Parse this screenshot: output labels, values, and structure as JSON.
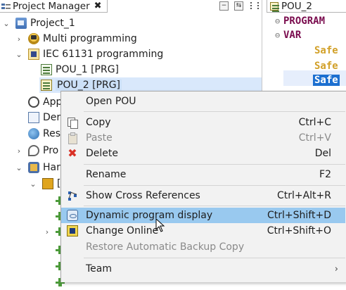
{
  "project_manager": {
    "tab_title": "Project Manager",
    "close_glyph": "✖",
    "toolbar": {
      "collapse_glyph": "−",
      "link_glyph": "⇆"
    },
    "tree": [
      {
        "label": "Project_1",
        "icon": "project-icon",
        "twisty": "expanded"
      },
      {
        "label": "Multi programming",
        "icon": "multi-programming-icon",
        "twisty": "collapsed"
      },
      {
        "label": "IEC 61131 programming",
        "icon": "iec-icon",
        "twisty": "expanded"
      },
      {
        "label": "POU_1 [PRG]",
        "icon": "pou-icon"
      },
      {
        "label": "POU_2 [PRG]",
        "icon": "pou-icon",
        "selected": true
      },
      {
        "label": "App",
        "icon": "gauge-icon"
      },
      {
        "label": "Der",
        "icon": "document-icon"
      },
      {
        "label": "Res",
        "icon": "globe-icon"
      },
      {
        "label": "Pro",
        "icon": "program-icon",
        "twisty": "collapsed"
      },
      {
        "label": "Har",
        "icon": "hardware-icon",
        "twisty": "expanded"
      },
      {
        "label": "[",
        "icon": "device-icon",
        "twisty": "expanded"
      }
    ]
  },
  "editor": {
    "tab_title": "POU_2",
    "lines": [
      {
        "fold": "⊖",
        "text": "PROGRAM",
        "kind": "keyword"
      },
      {
        "fold": "⊖",
        "text": "VAR",
        "kind": "keyword"
      },
      {
        "text": "Safe",
        "kind": "identifier"
      },
      {
        "text": "Safe",
        "kind": "identifier"
      },
      {
        "text": "Safe",
        "kind": "identifier-selected"
      }
    ]
  },
  "context_menu": {
    "items": [
      {
        "label": "Open POU",
        "shortcut": "",
        "icon": "",
        "enabled": true
      },
      {
        "separator": true
      },
      {
        "label": "Copy",
        "shortcut": "Ctrl+C",
        "icon": "copy-icon",
        "enabled": true
      },
      {
        "label": "Paste",
        "shortcut": "Ctrl+V",
        "icon": "paste-icon",
        "enabled": false
      },
      {
        "label": "Delete",
        "shortcut": "Del",
        "icon": "delete-icon",
        "enabled": true
      },
      {
        "separator": true
      },
      {
        "label": "Rename",
        "shortcut": "F2",
        "icon": "",
        "enabled": true
      },
      {
        "separator": true
      },
      {
        "label": "Show Cross References",
        "shortcut": "Ctrl+Alt+R",
        "icon": "cross-references-icon",
        "enabled": true
      },
      {
        "separator": true
      },
      {
        "label": "Dynamic program display",
        "shortcut": "Ctrl+Shift+D",
        "icon": "dynamic-display-icon",
        "enabled": true,
        "hover": true
      },
      {
        "label": "Change Online",
        "shortcut": "Ctrl+Shift+O",
        "icon": "change-online-icon",
        "enabled": true
      },
      {
        "label": "Restore Automatic Backup Copy",
        "shortcut": "",
        "icon": "",
        "enabled": false
      },
      {
        "separator": true
      },
      {
        "label": "Team",
        "shortcut": "",
        "icon": "",
        "enabled": true,
        "submenu": "›"
      }
    ],
    "delete_glyph": "✖"
  },
  "colors": {
    "menu_hover": "#99c9ef",
    "keyword": "#7a0c4e",
    "identifier": "#d2a12a",
    "selection": "#1c6fd0"
  }
}
